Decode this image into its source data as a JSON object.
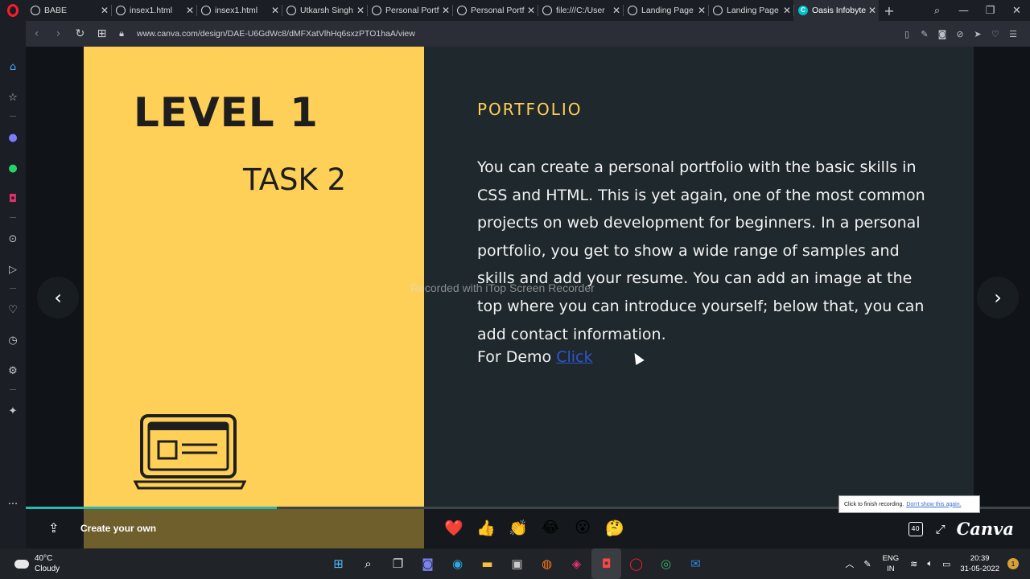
{
  "browser": {
    "tabs": [
      {
        "label": "BABE"
      },
      {
        "label": "insex1.html"
      },
      {
        "label": "insex1.html"
      },
      {
        "label": "Utkarsh Singh"
      },
      {
        "label": "Personal Portf"
      },
      {
        "label": "Personal Portf"
      },
      {
        "label": "file:///C:/User"
      },
      {
        "label": "Landing Page"
      },
      {
        "label": "Landing Page"
      },
      {
        "label": "Oasis Infobyte"
      }
    ],
    "url": "www.canva.com/design/DAE-U6GdWc8/dMFXatVlhHq6sxzPTO1haA/view"
  },
  "slide": {
    "level": "LEVEL 1",
    "task": "TASK 2",
    "heading": "PORTFOLIO",
    "description": "You can create a personal portfolio with the basic skills in CSS and HTML. This is yet again, one of the most common projects on web development for beginners. In a personal portfolio, you get to show a wide range of samples and skills and add your resume. You can add an image at the top where you can introduce yourself; below that, you can add contact information.",
    "demo_label": "For Demo",
    "demo_link": "Click"
  },
  "watermark": "Recorded with iTop Screen Recorder",
  "viewer_bar": {
    "create_label": "Create your own",
    "progress": 0.25,
    "page_badge": "40",
    "logo": "Canva",
    "reactions": [
      "❤️",
      "👍",
      "👏",
      "😂",
      "😮",
      "🤔"
    ]
  },
  "tooltip": {
    "text": "Click to finish recording.",
    "link": "Don't show this again."
  },
  "taskbar": {
    "temperature": "40°C",
    "weather": "Cloudy",
    "lang_1": "ENG",
    "lang_2": "IN",
    "time": "20:39",
    "date": "31-05-2022",
    "notifications": "1"
  },
  "colors": {
    "slide_yellow": "#ffd058",
    "slide_dark": "#1f282c",
    "link_blue": "#2f55d4",
    "progress_teal": "#2bb8b0"
  }
}
